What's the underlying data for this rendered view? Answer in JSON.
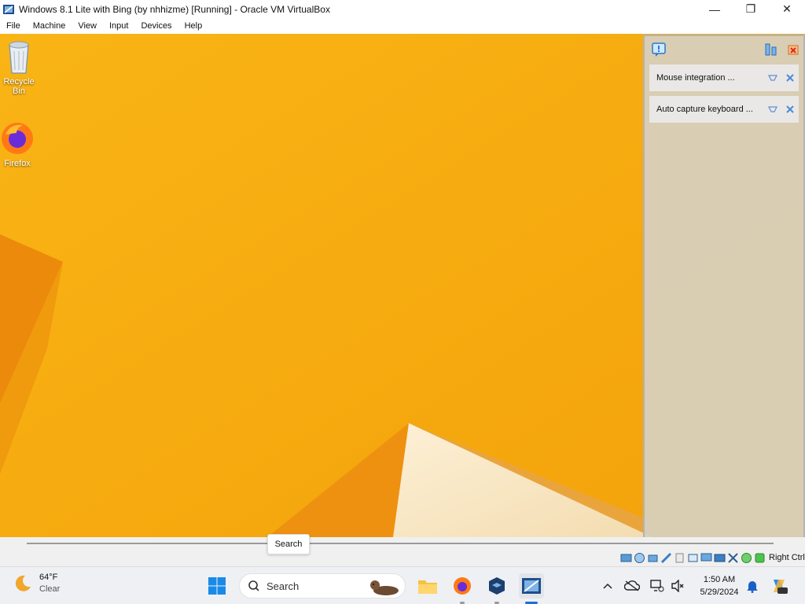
{
  "window": {
    "title": "Windows 8.1 Lite with Bing (by nhhizme) [Running] - Oracle VM VirtualBox",
    "minimize_symbol": "—",
    "maximize_symbol": "❐",
    "close_symbol": "✕"
  },
  "menu": {
    "items": [
      "File",
      "Machine",
      "View",
      "Input",
      "Devices",
      "Help"
    ]
  },
  "desktop": {
    "icons": [
      {
        "label": "Recycle Bin",
        "icon": "recycle-bin-icon"
      },
      {
        "label": "Firefox",
        "icon": "firefox-icon"
      }
    ],
    "background_color": "#f7ae0f"
  },
  "notification_panel": {
    "notifications": [
      {
        "text": "Mouse integration ..."
      },
      {
        "text": "Auto capture keyboard ..."
      }
    ]
  },
  "statusbar": {
    "tooltip": "Search",
    "host_key": "Right Ctrl",
    "icons": [
      "hard-disk-icon",
      "optical-drive-icon",
      "audio-icon",
      "network-icon",
      "usb-icon",
      "shared-folder-icon",
      "display-icon",
      "video-capture-icon",
      "recording-icon",
      "cpu-icon",
      "mouse-integration-icon",
      "keyboard-icon"
    ]
  },
  "taskbar": {
    "weather_temp": "64°F",
    "weather_condition": "Clear",
    "search_label": "Search",
    "time": "1:50 AM",
    "date": "5/29/2024",
    "apps": [
      "start-icon",
      "file-explorer-icon",
      "firefox-icon",
      "virtualbox-icon",
      "vm-window-icon"
    ]
  }
}
